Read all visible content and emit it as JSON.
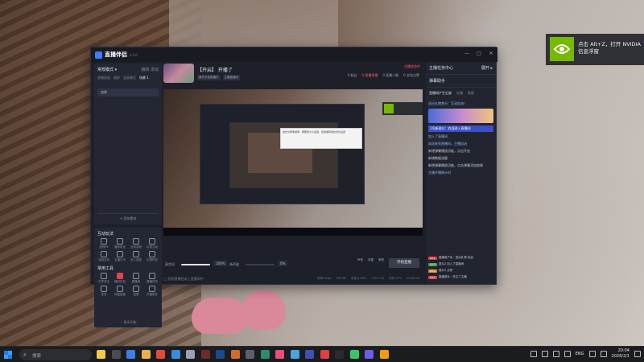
{
  "app": {
    "brand": "直播伴侣",
    "version": "v.5.0"
  },
  "window_controls": [
    "—",
    "□",
    "✕"
  ],
  "scene_panel": {
    "title": "常规模式 ▾",
    "actions": "编辑  添加",
    "tabs": [
      "直播画面",
      "横屏",
      "竖屏模式",
      "场景 1"
    ],
    "item": "点评",
    "add_source": "+ 添加素材"
  },
  "tools_panel": {
    "interact_title": "互动玩法",
    "interact": [
      "连线PK",
      "福利玩法",
      "互动游戏",
      "礼物互动",
      "涂鸦互动",
      "主播口令",
      "多人连麦",
      "礼物任务"
    ],
    "common_title": "常用工具",
    "common": [
      "引导关注",
      "福利红包",
      "直播间",
      "直播任务",
      "任务",
      "转盘抽奖",
      "投票",
      "开播助手"
    ],
    "more": "··· 更多功能"
  },
  "header": {
    "room_title": "【开启】 开播了",
    "tags": [
      "娱乐天地直播中",
      "主播直播间"
    ],
    "stats": [
      "0 粉丝",
      "0 直播人数",
      "0 本场点赞"
    ],
    "alert": "0 直播停播",
    "live_badge": "主播状态中"
  },
  "preview": {
    "tooltip": "最长分辨率帧率，按照原大小设置，自动保存优化对比设置"
  },
  "controls": {
    "mic_label": "麦克风",
    "mic_value": "100%",
    "mic_level": 1.0,
    "speaker_label": "扬声器",
    "speaker_value": "0%",
    "speaker_level": 0.0,
    "buttons": [
      "声音",
      "设置",
      "美颜"
    ],
    "start": "开始直播"
  },
  "status": {
    "left": "◯ 您的直播还未上直播间中",
    "right": [
      "码率:0kb/s",
      "FPS:60",
      "丢帧:0.00%",
      "CPU:17%",
      "内存:27%",
      "00:00:00"
    ]
  },
  "right_panel": {
    "title": "主播任务中心",
    "open": "展开 ▸",
    "section": "弹幕助手",
    "tabs": [
      "直播间产生记录",
      "礼物",
      "贴纸"
    ],
    "messages": [
      "送出礼物赏分：互动加油！",
      "加入了直播间",
      "欢迎来到直播间，主播加油",
      "新增弹幕播放功能，点击开启",
      "新增数据流量",
      "新增弹幕播放功能，点击弹幕添加效果",
      "主播开播倒计时"
    ],
    "highlight": "1号新观众：欢迎进入直播间",
    "chat": [
      {
        "chip": "LV.1",
        "color": "r",
        "text": "直播用户名 · 送出礼物 欢迎"
      },
      {
        "chip": "LV.3",
        "color": "g",
        "text": "观众2 加入了直播间"
      },
      {
        "chip": "LV.2",
        "color": "o",
        "text": "观众3 点赞"
      },
      {
        "chip": "LV.1",
        "color": "r",
        "text": "直播观众 · 关注了主播"
      }
    ]
  },
  "nvidia_toast": {
    "text": "点击 Alt+Z，打开 NVIDIA 信息浮窗"
  },
  "taskbar": {
    "search_placeholder": "搜索",
    "lang": "ENG",
    "time": "20:04",
    "date": "2026/2/1"
  }
}
